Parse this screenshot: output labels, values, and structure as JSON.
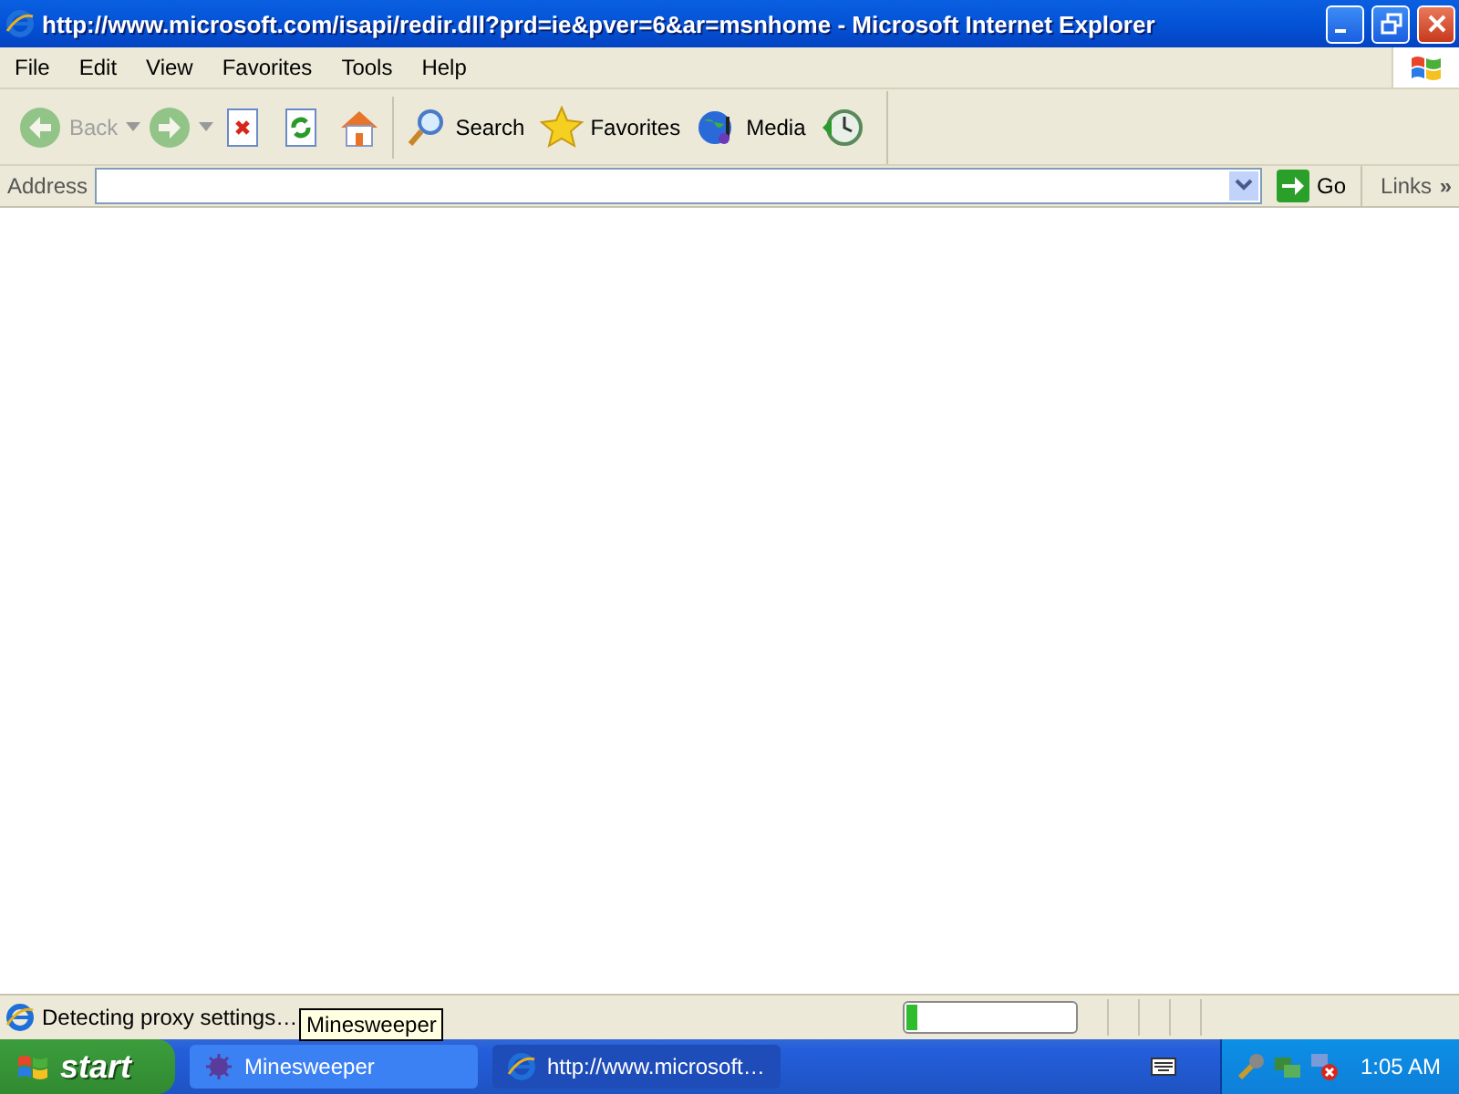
{
  "window": {
    "title": "http://www.microsoft.com/isapi/redir.dll?prd=ie&pver=6&ar=msnhome - Microsoft Internet Explorer"
  },
  "menu": [
    "File",
    "Edit",
    "View",
    "Favorites",
    "Tools",
    "Help"
  ],
  "toolbar": [
    {
      "kind": "back",
      "label": "Back",
      "disabled": true
    },
    {
      "kind": "forward",
      "disabled": true
    },
    {
      "kind": "stop",
      "disabled": false
    },
    {
      "kind": "refresh",
      "disabled": false
    },
    {
      "kind": "home",
      "disabled": false
    },
    {
      "kind": "search",
      "label": "Search",
      "disabled": false
    },
    {
      "kind": "favorites",
      "label": "Favorites",
      "disabled": false
    },
    {
      "kind": "media",
      "label": "Media",
      "disabled": false
    },
    {
      "kind": "history",
      "disabled": false
    }
  ],
  "address": {
    "label": "Address",
    "go": "Go",
    "links": "Links",
    "more": "»"
  },
  "status_bar": {
    "text": "Detecting proxy settings…",
    "progress": {
      "level": 0.06
    }
  },
  "tooltip": "Minesweeper",
  "taskbar": {
    "start": "start",
    "tasks": [
      {
        "kind": "game",
        "label": "Minesweeper",
        "selected": false
      },
      {
        "kind": "browser",
        "label": "http://www.microsoft…",
        "selected": true
      }
    ],
    "clock": "1:05 AM"
  }
}
